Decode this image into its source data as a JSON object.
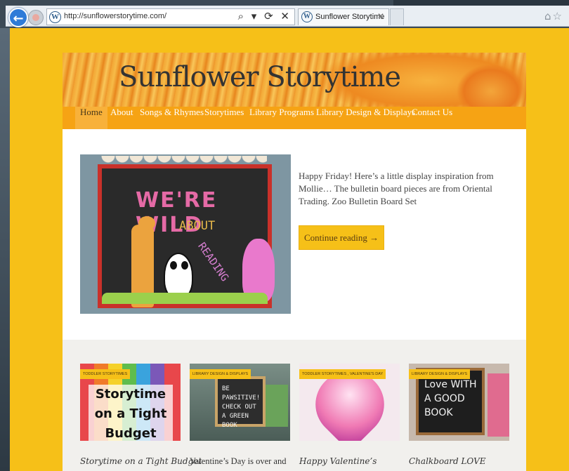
{
  "browser": {
    "url": "http://sunflowerstorytime.com/",
    "address_controls": "⌕ ▾ ⟳ ✕",
    "tab_title": "Sunflower Storytime",
    "tab_close": "✕",
    "right_icons": "⌂☆"
  },
  "site": {
    "title": "Sunflower Storytime",
    "nav": [
      "Home",
      "About",
      "Songs & Rhymes",
      "Storytimes",
      "Library Programs",
      "Library Design & Displays",
      "Contact Us"
    ],
    "active_nav": "Home"
  },
  "featured": {
    "image_text": {
      "title": "WE'RE WILD",
      "about": "ABOUT",
      "reading": "READING"
    },
    "excerpt": "Happy Friday!  Here’s a little display inspiration from Mollie… The bulletin board pieces are from Oriental Trading. Zoo Bulletin Board Set",
    "continue_label": "Continue reading →"
  },
  "cards": [
    {
      "tag": "TODDLER STORYTIMES",
      "title": "Storytime on a Tight Budget",
      "thumb_text": "Storytime on a Tight Budget"
    },
    {
      "tag": "LIBRARY DESIGN & DISPLAYS",
      "title": "Valentine’s Day is over and",
      "thumb_text": "BE PAWSITIVE! CHECK OUT A GREEN BOOK"
    },
    {
      "tag": "TODDLER STORYTIMES , VALENTINE'S DAY",
      "title": "Happy Valentine’s",
      "thumb_text": ""
    },
    {
      "tag": "LIBRARY DESIGN & DISPLAYS",
      "title": "Chalkboard LOVE",
      "thumb_text": "Love WITH A GOOD BOOK"
    }
  ]
}
